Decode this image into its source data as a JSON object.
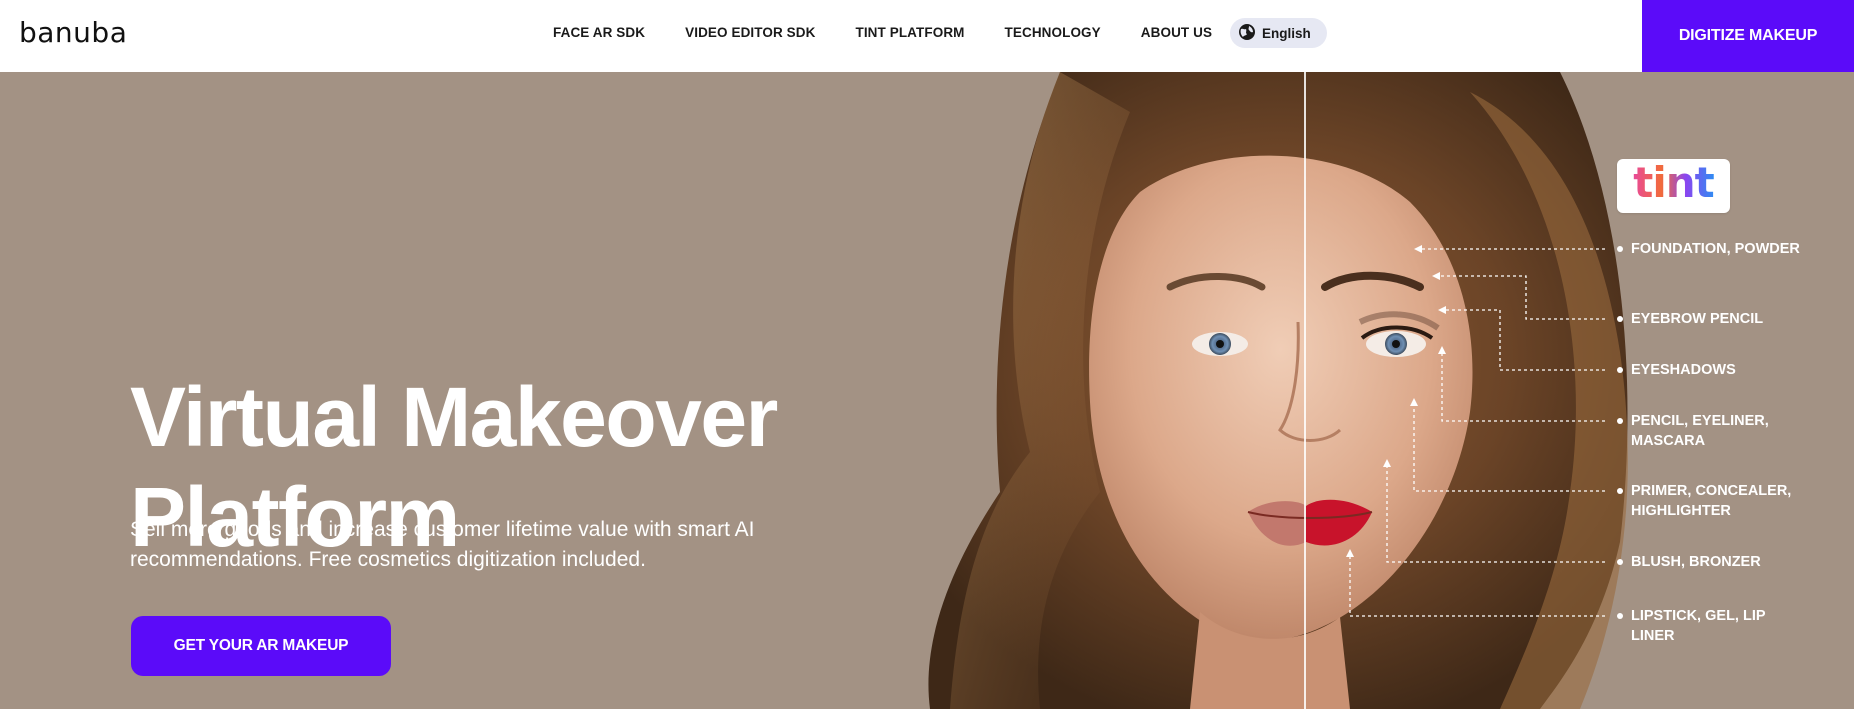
{
  "header": {
    "logo_text": "banuba",
    "nav": [
      "FACE AR SDK",
      "VIDEO EDITOR SDK",
      "TINT PLATFORM",
      "TECHNOLOGY",
      "ABOUT US"
    ],
    "language": "English",
    "cta_label": "DIGITIZE MAKEUP"
  },
  "hero": {
    "title_line1": "Virtual Makeover",
    "title_line2": "Platform",
    "subtitle": "Sell more goods and increase customer lifetime value with smart AI recommendations. Free cosmetics digitization included.",
    "cta_label": "GET YOUR AR MAKEUP"
  },
  "tint": {
    "badge_text": "tint",
    "labels": [
      "FOUNDATION, POWDER",
      "EYEBROW PENCIL",
      "EYESHADOWS",
      "PENCIL, EYELINER, MASCARA",
      "PRIMER, CONCEALER, HIGHLIGHTER",
      "BLUSH, BRONZER",
      "LIPSTICK, GEL, LIP LINER"
    ]
  },
  "colors": {
    "accent": "#5b0bf9",
    "hero_bg": "#a39284",
    "header_bg": "#ffffff",
    "language_pill_bg": "#e6e8f3"
  },
  "icons": {
    "language": "globe-icon"
  }
}
